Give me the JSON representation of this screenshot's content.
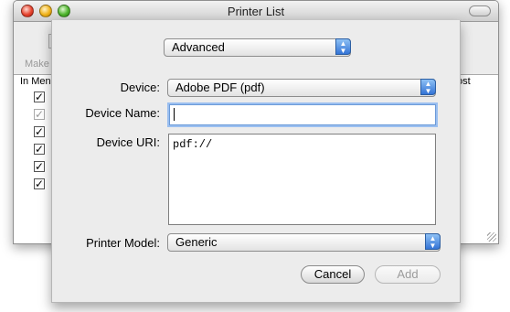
{
  "window": {
    "title": "Printer List"
  },
  "toolbar": {
    "make_default_label": "Make"
  },
  "table": {
    "columns": [
      "In Men",
      "ost"
    ],
    "rows": [
      {
        "checked": true,
        "dimmed": false
      },
      {
        "checked": true,
        "dimmed": true
      },
      {
        "checked": true,
        "dimmed": false
      },
      {
        "checked": true,
        "dimmed": false
      },
      {
        "checked": true,
        "dimmed": false
      },
      {
        "checked": true,
        "dimmed": false
      }
    ]
  },
  "sheet": {
    "mode_popup": "Advanced",
    "device_label": "Device:",
    "device_value": "Adobe PDF (pdf)",
    "device_name_label": "Device Name:",
    "device_name_value": "",
    "device_uri_label": "Device URI:",
    "device_uri_value": "pdf://",
    "printer_model_label": "Printer Model:",
    "printer_model_value": "Generic",
    "cancel_label": "Cancel",
    "add_label": "Add"
  },
  "colors": {
    "accent": "#3474d6",
    "focus_ring": "#9bbff0"
  }
}
